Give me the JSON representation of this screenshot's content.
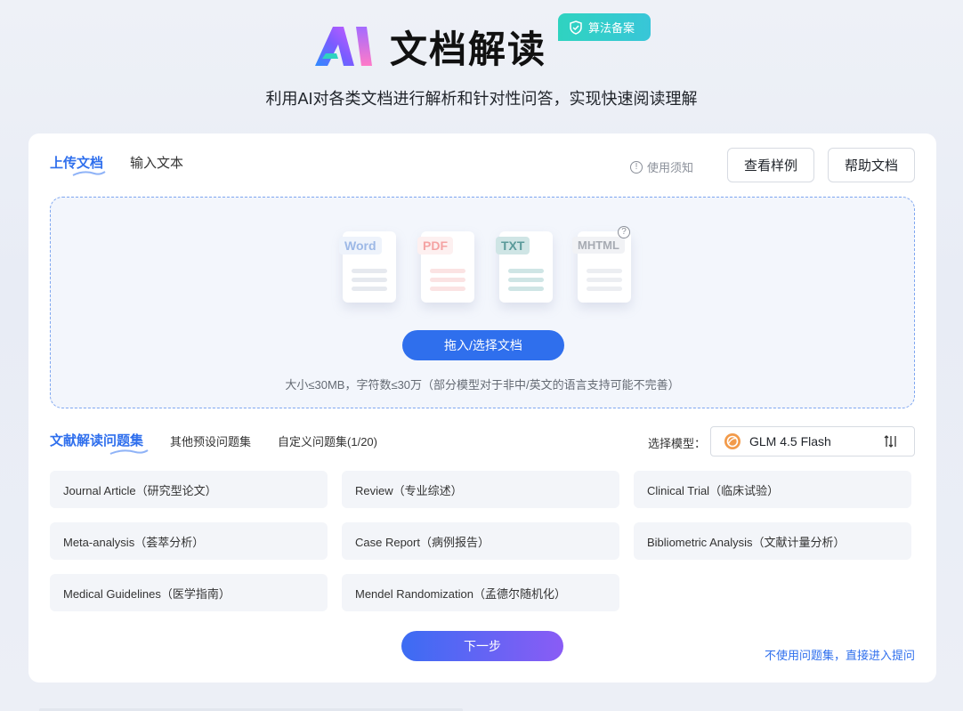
{
  "header": {
    "brand_title": "文档解读",
    "badge_text": "算法备案",
    "subtitle": "利用AI对各类文档进行解析和针对性问答，实现快速阅读理解"
  },
  "tabs": [
    {
      "label": "上传文档",
      "active": true
    },
    {
      "label": "输入文本",
      "active": false
    }
  ],
  "toolbar": {
    "notice_label": "使用须知",
    "sample_button": "查看样例",
    "help_button": "帮助文档"
  },
  "upload": {
    "file_types": [
      "Word",
      "PDF",
      "TXT",
      "MHTML"
    ],
    "button_label": "拖入/选择文档",
    "limit_text": "大小≤30MB，字符数≤30万（部分模型对于非中/英文的语言支持可能不完善）"
  },
  "question_tabs": [
    {
      "label": "文献解读问题集",
      "active": true
    },
    {
      "label": "其他预设问题集",
      "active": false
    },
    {
      "label": "自定义问题集(1/20)",
      "active": false
    }
  ],
  "model": {
    "label": "选择模型：",
    "selected": "GLM 4.5 Flash"
  },
  "question_sets": [
    "Journal Article（研究型论文）",
    "Review（专业综述）",
    "Clinical Trial（临床试验）",
    "Meta-analysis（荟萃分析）",
    "Case Report（病例报告）",
    "Bibliometric Analysis（文献计量分析）",
    "Medical Guidelines（医学指南）",
    "Mendel Randomization（孟德尔随机化）"
  ],
  "actions": {
    "next_button": "下一步",
    "skip_link": "不使用问题集，直接进入提问"
  },
  "colors": {
    "accent": "#2f6fed",
    "badge": "#2fd3c0"
  }
}
